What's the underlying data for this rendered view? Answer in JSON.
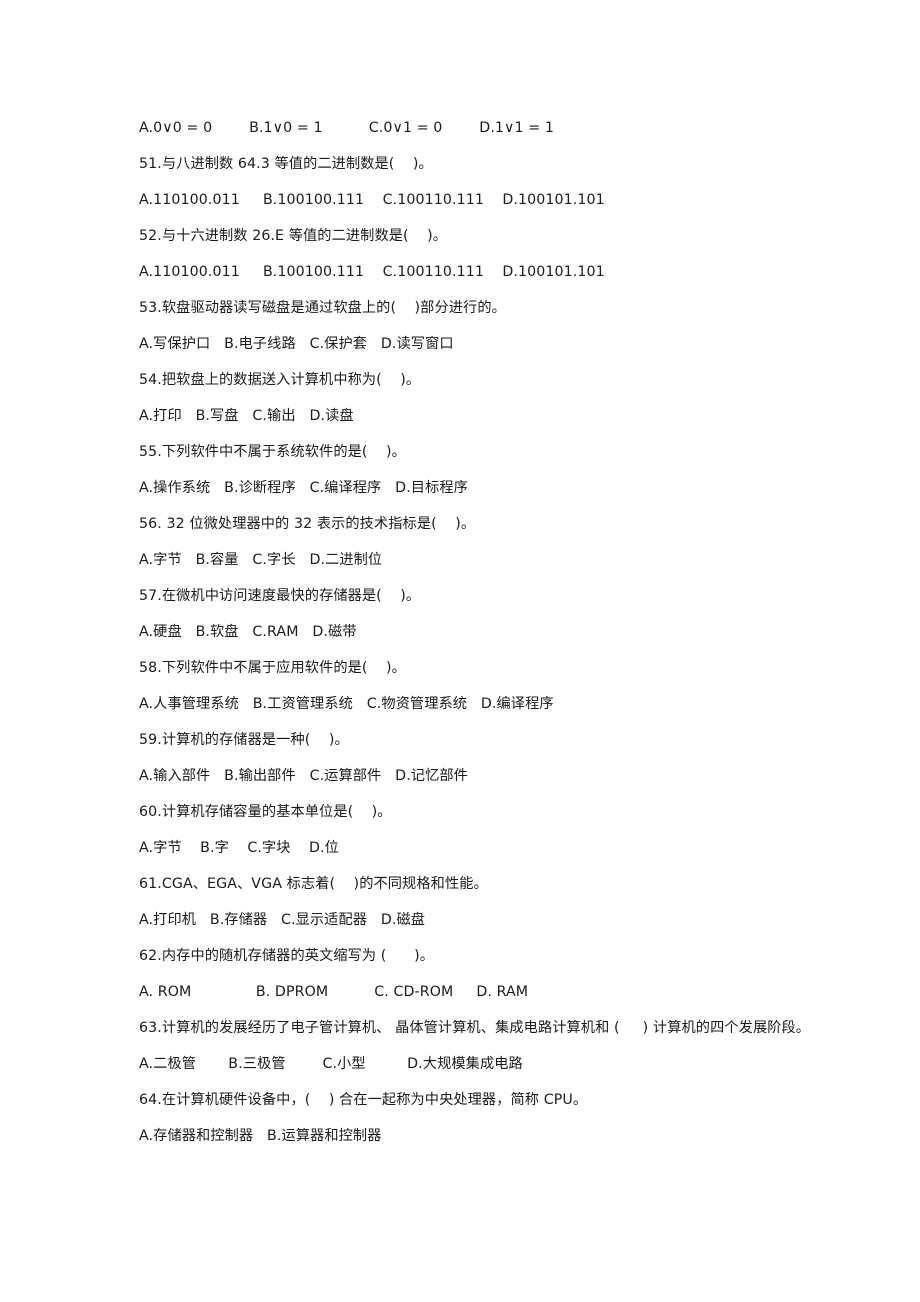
{
  "document": {
    "type": "exam-question-paper",
    "subject_hint": "计算机基础 单项选择题",
    "background_color": "#ffffff",
    "text_color": "#1b1b1b"
  },
  "lines": [
    {
      "kind": "options",
      "name": "options-q50",
      "text": "A.0∨0 = 0        B.1∨0 = 1          C.0∨1 = 0        D.1∨1 = 1"
    },
    {
      "kind": "question",
      "name": "question-51",
      "text": "51.与八进制数 64.3 等值的二进制数是(    )。"
    },
    {
      "kind": "options",
      "name": "options-q51",
      "text": "A.110100.011     B.100100.111    C.100110.111    D.100101.101"
    },
    {
      "kind": "question",
      "name": "question-52",
      "text": "52.与十六进制数 26.E 等值的二进制数是(    )。"
    },
    {
      "kind": "options",
      "name": "options-q52",
      "text": "A.110100.011     B.100100.111    C.100110.111    D.100101.101"
    },
    {
      "kind": "question",
      "name": "question-53",
      "text": "53.软盘驱动器读写磁盘是通过软盘上的(    )部分进行的。"
    },
    {
      "kind": "options",
      "name": "options-q53",
      "text": "A.写保护口   B.电子线路   C.保护套   D.读写窗口"
    },
    {
      "kind": "question",
      "name": "question-54",
      "text": "54.把软盘上的数据送入计算机中称为(    )。"
    },
    {
      "kind": "options",
      "name": "options-q54",
      "text": "A.打印   B.写盘   C.输出   D.读盘"
    },
    {
      "kind": "question",
      "name": "question-55",
      "text": "55.下列软件中不属于系统软件的是(    )。"
    },
    {
      "kind": "options",
      "name": "options-q55",
      "text": "A.操作系统   B.诊断程序   C.编译程序   D.目标程序"
    },
    {
      "kind": "question",
      "name": "question-56",
      "text": "56. 32 位微处理器中的 32 表示的技术指标是(    )。"
    },
    {
      "kind": "options",
      "name": "options-q56",
      "text": "A.字节   B.容量   C.字长   D.二进制位"
    },
    {
      "kind": "question",
      "name": "question-57",
      "text": "57.在微机中访问速度最快的存储器是(    )。"
    },
    {
      "kind": "options",
      "name": "options-q57",
      "text": "A.硬盘   B.软盘   C.RAM   D.磁带"
    },
    {
      "kind": "question",
      "name": "question-58",
      "text": "58.下列软件中不属于应用软件的是(    )。"
    },
    {
      "kind": "options",
      "name": "options-q58",
      "text": "A.人事管理系统   B.工资管理系统   C.物资管理系统   D.编译程序"
    },
    {
      "kind": "question",
      "name": "question-59",
      "text": "59.计算机的存储器是一种(    )。"
    },
    {
      "kind": "options",
      "name": "options-q59",
      "text": "A.输入部件   B.输出部件   C.运算部件   D.记忆部件"
    },
    {
      "kind": "question",
      "name": "question-60",
      "text": "60.计算机存储容量的基本单位是(    )。"
    },
    {
      "kind": "options",
      "name": "options-q60",
      "text": "A.字节    B.字    C.字块    D.位"
    },
    {
      "kind": "question",
      "name": "question-61",
      "text": "61.CGA、EGA、VGA 标志着(    )的不同规格和性能。"
    },
    {
      "kind": "options",
      "name": "options-q61",
      "text": "A.打印机   B.存储器   C.显示适配器   D.磁盘"
    },
    {
      "kind": "question",
      "name": "question-62",
      "text": "62.内存中的随机存储器的英文缩写为 (      )。"
    },
    {
      "kind": "options",
      "name": "options-q62",
      "text": "A. ROM              B. DPROM          C. CD-ROM     D. RAM"
    },
    {
      "kind": "question",
      "name": "question-63",
      "text": "63.计算机的发展经历了电子管计算机、 晶体管计算机、集成电路计算机和 (     ) 计算机的四个发展阶段。"
    },
    {
      "kind": "options",
      "name": "options-q63",
      "text": "A.二极管       B.三极管        C.小型         D.大规模集成电路"
    },
    {
      "kind": "question",
      "name": "question-64",
      "text": "64.在计算机硬件设备中，(    ) 合在一起称为中央处理器，简称 CPU。"
    },
    {
      "kind": "options",
      "name": "options-q64",
      "text": "A.存储器和控制器   B.运算器和控制器"
    }
  ]
}
